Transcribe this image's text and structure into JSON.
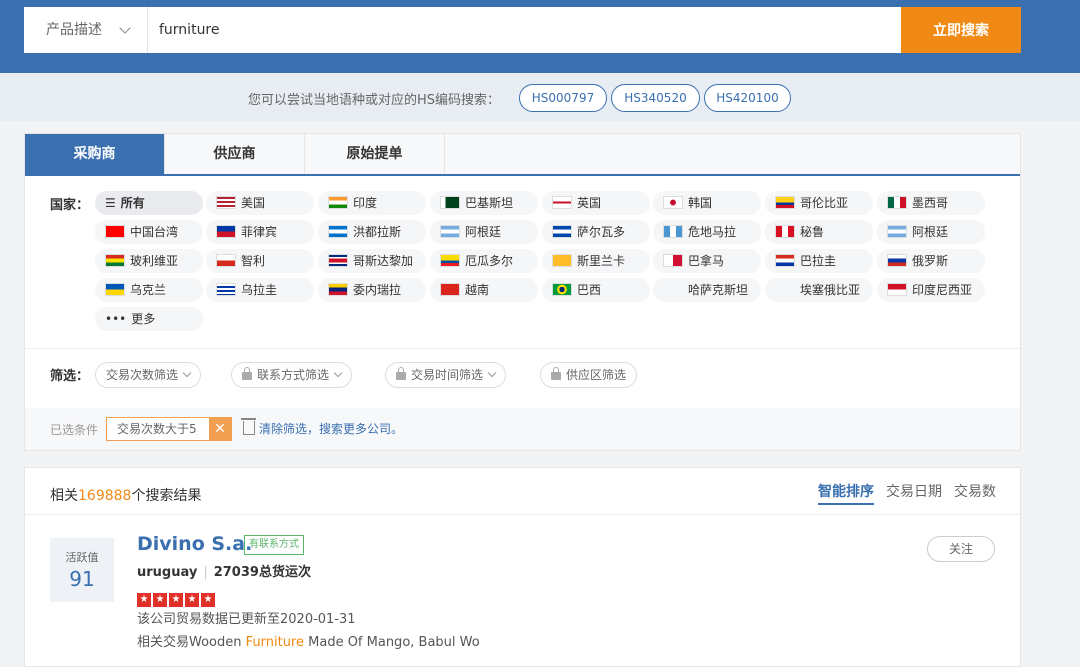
{
  "search": {
    "type_label": "产品描述",
    "query": "furniture",
    "button": "立即搜索"
  },
  "hint": {
    "text": "您可以尝试当地语种或对应的HS编码搜索：",
    "codes": [
      "HS000797",
      "HS340520",
      "HS420100"
    ]
  },
  "tabs": [
    "采购商",
    "供应商",
    "原始提单"
  ],
  "countries_label": "国家：",
  "countries": [
    {
      "name": "所有",
      "flag": "list"
    },
    {
      "name": "美国",
      "flag": "us"
    },
    {
      "name": "印度",
      "flag": "in"
    },
    {
      "name": "巴基斯坦",
      "flag": "pk"
    },
    {
      "name": "英国",
      "flag": "gb"
    },
    {
      "name": "韩国",
      "flag": "kr"
    },
    {
      "name": "哥伦比亚",
      "flag": "co"
    },
    {
      "name": "墨西哥",
      "flag": "mx"
    },
    {
      "name": "中国台湾",
      "flag": "tw"
    },
    {
      "name": "菲律宾",
      "flag": "ph"
    },
    {
      "name": "洪都拉斯",
      "flag": "hn"
    },
    {
      "name": "阿根廷",
      "flag": "ar"
    },
    {
      "name": "萨尔瓦多",
      "flag": "sv"
    },
    {
      "name": "危地马拉",
      "flag": "gt"
    },
    {
      "name": "秘鲁",
      "flag": "pe"
    },
    {
      "name": "阿根廷",
      "flag": "ar"
    },
    {
      "name": "玻利维亚",
      "flag": "bo"
    },
    {
      "name": "智利",
      "flag": "cl"
    },
    {
      "name": "哥斯达黎加",
      "flag": "cr"
    },
    {
      "name": "厄瓜多尔",
      "flag": "ec"
    },
    {
      "name": "斯里兰卡",
      "flag": "lk"
    },
    {
      "name": "巴拿马",
      "flag": "pa"
    },
    {
      "name": "巴拉圭",
      "flag": "py"
    },
    {
      "name": "俄罗斯",
      "flag": "ru"
    },
    {
      "name": "乌克兰",
      "flag": "ua"
    },
    {
      "name": "乌拉圭",
      "flag": "uy"
    },
    {
      "name": "委内瑞拉",
      "flag": "ve"
    },
    {
      "name": "越南",
      "flag": "vn"
    },
    {
      "name": "巴西",
      "flag": "br"
    },
    {
      "name": "哈萨克斯坦",
      "flag": "none"
    },
    {
      "name": "埃塞俄比亚",
      "flag": "none"
    },
    {
      "name": "印度尼西亚",
      "flag": "id"
    },
    {
      "name": "更多",
      "flag": "more"
    }
  ],
  "filters_label": "筛选：",
  "filters": [
    {
      "label": "交易次数筛选",
      "locked": false
    },
    {
      "label": "联系方式筛选",
      "locked": true
    },
    {
      "label": "交易时间筛选",
      "locked": true
    },
    {
      "label": "供应区筛选",
      "locked": true
    }
  ],
  "selected": {
    "label": "已选条件",
    "chip": "交易次数大于5",
    "clear": "清除筛选，搜索更多公司。"
  },
  "results": {
    "prefix": "相关",
    "count": "169888",
    "suffix": "个搜索结果",
    "sort": [
      "智能排序",
      "交易日期",
      "交易数"
    ]
  },
  "item": {
    "activity_label": "活跃值",
    "activity_value": "91",
    "name": "Divino S.a.",
    "badge": "有联系方式",
    "country": "uruguay",
    "shipments": "27039总货运次",
    "updated": "该公司贸易数据已更新至2020-01-31",
    "related_prefix": "相关交易Wooden ",
    "related_hl": "Furniture",
    "related_suffix": " Made Of Mango, Babul Wo",
    "follow": "关注"
  },
  "colors": {
    "brand": "#3a6fb0",
    "accent": "#f08a14"
  }
}
